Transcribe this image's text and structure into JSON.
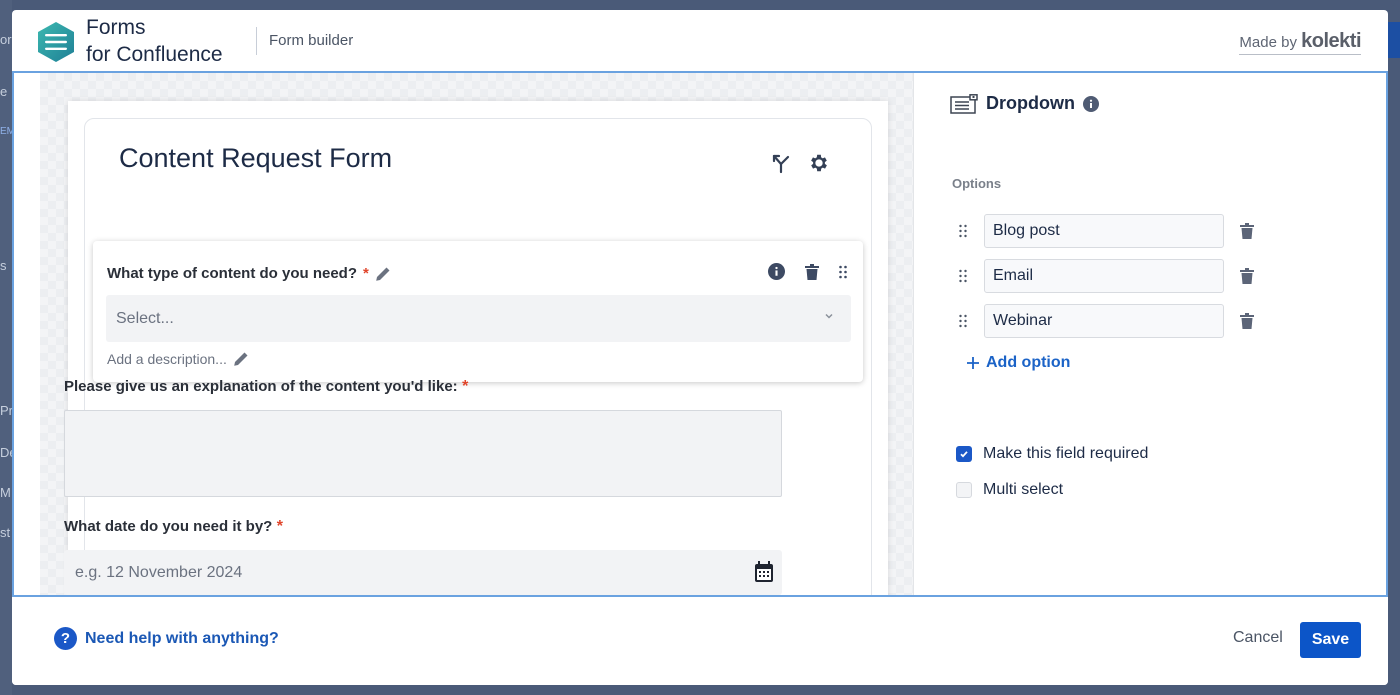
{
  "background": {
    "fragments": [
      "or",
      "e",
      "EM",
      "s",
      "Pr",
      "De",
      "M",
      "st"
    ]
  },
  "header": {
    "brand_line1": "Forms",
    "brand_line2": "for Confluence",
    "subtitle": "Form builder",
    "made_by_prefix": "Made by",
    "made_by_brand": "kolekti"
  },
  "form": {
    "title": "Content Request Form",
    "fields": [
      {
        "label": "What type of content do you need?",
        "required_mark": "*",
        "type": "dropdown",
        "placeholder": "Select...",
        "description_placeholder": "Add a description..."
      },
      {
        "label": "Please give us an explanation of the content you'd like:",
        "required_mark": "*",
        "type": "textarea"
      },
      {
        "label": "What date do you need it by?",
        "required_mark": "*",
        "type": "date",
        "placeholder": "e.g. 12 November 2024"
      }
    ]
  },
  "side_panel": {
    "field_type": "Dropdown",
    "options_label": "Options",
    "options": [
      "Blog post",
      "Email",
      "Webinar"
    ],
    "add_option_label": "Add option",
    "required_label": "Make this field required",
    "required_checked": true,
    "multi_select_label": "Multi select",
    "multi_select_checked": false
  },
  "footer": {
    "help_label": "Need help with anything?",
    "cancel_label": "Cancel",
    "save_label": "Save"
  },
  "colors": {
    "accent": "#0c55c8",
    "required": "#e0452b",
    "logo": "#2a9da0"
  }
}
